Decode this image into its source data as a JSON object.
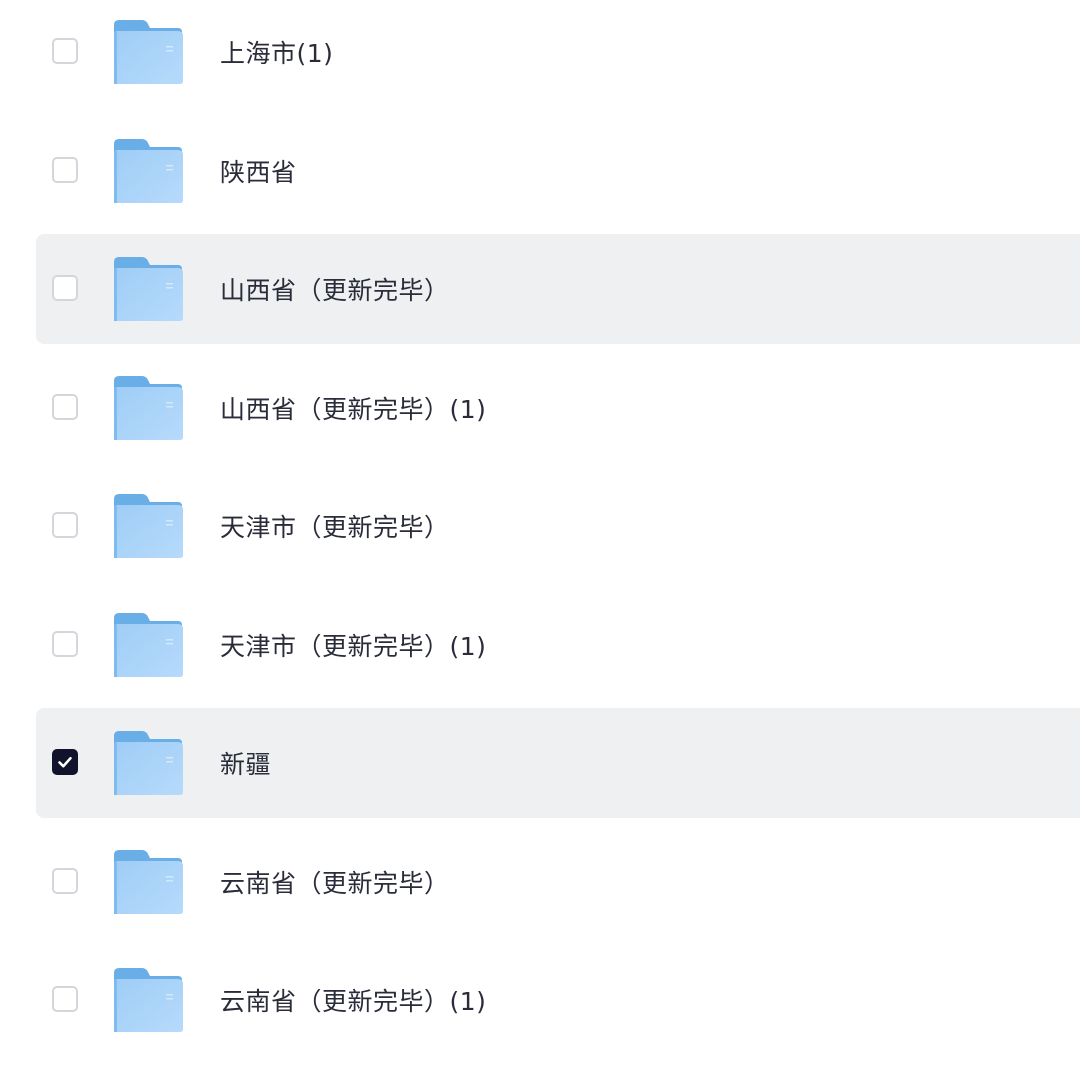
{
  "files": [
    {
      "name": "上海市(1)",
      "checked": false,
      "highlighted": false,
      "icon": "folder-icon"
    },
    {
      "name": "陕西省",
      "checked": false,
      "highlighted": false,
      "icon": "folder-icon"
    },
    {
      "name": "山西省（更新完毕）",
      "checked": false,
      "highlighted": true,
      "icon": "folder-icon"
    },
    {
      "name": "山西省（更新完毕）(1)",
      "checked": false,
      "highlighted": false,
      "icon": "folder-icon"
    },
    {
      "name": "天津市（更新完毕）",
      "checked": false,
      "highlighted": false,
      "icon": "folder-icon"
    },
    {
      "name": "天津市（更新完毕）(1)",
      "checked": false,
      "highlighted": false,
      "icon": "folder-icon"
    },
    {
      "name": "新疆",
      "checked": true,
      "highlighted": true,
      "icon": "folder-icon"
    },
    {
      "name": "云南省（更新完毕）",
      "checked": false,
      "highlighted": false,
      "icon": "folder-icon"
    },
    {
      "name": "云南省（更新完毕）(1)",
      "checked": false,
      "highlighted": false,
      "icon": "folder-icon"
    }
  ],
  "colors": {
    "highlight_row": "#eff0f2",
    "checkbox_checked": "#10132b",
    "folder_blue": "#8ec4f3"
  }
}
